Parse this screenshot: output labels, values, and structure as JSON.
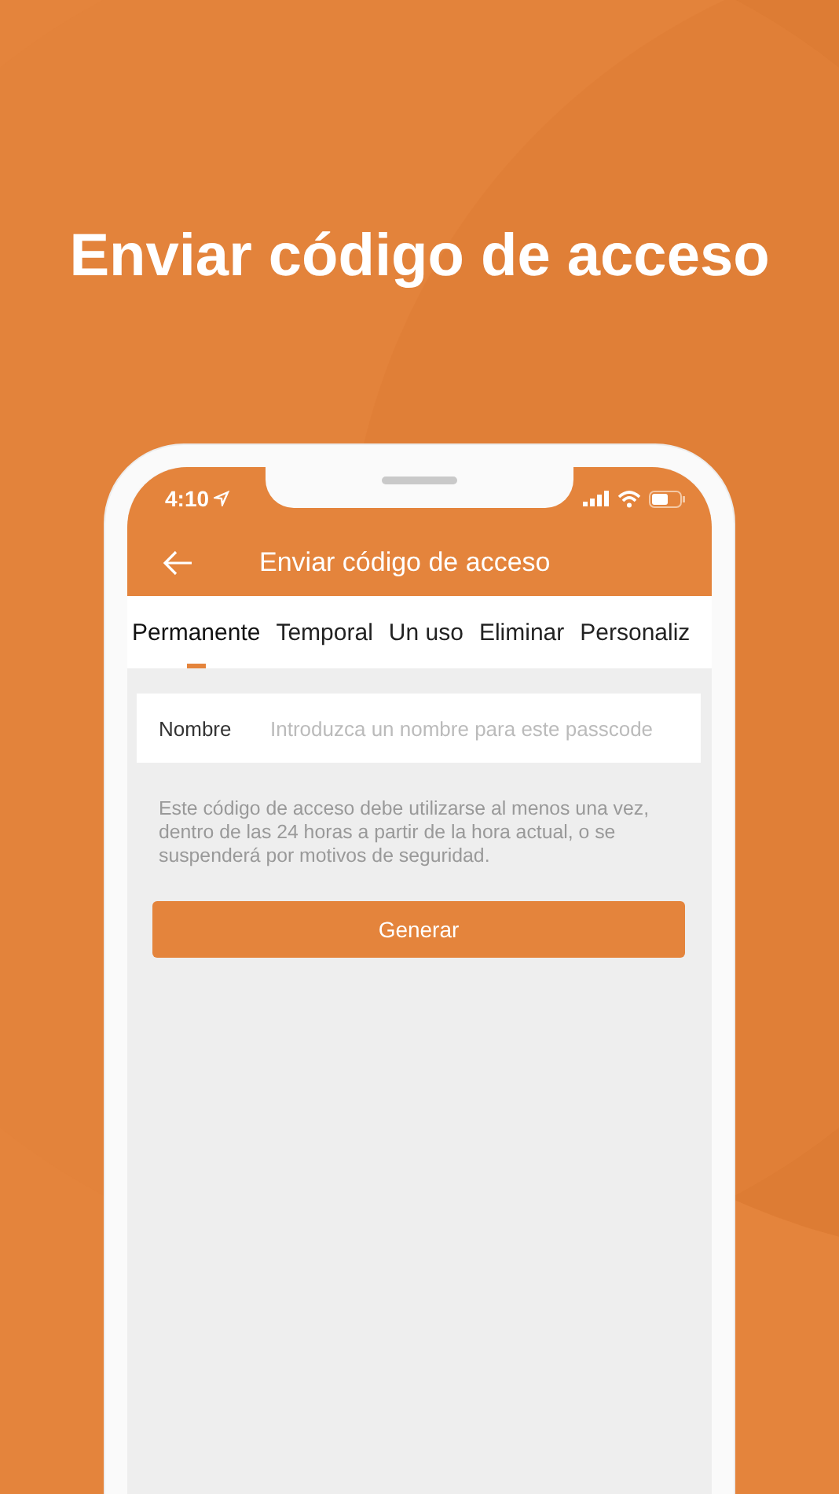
{
  "headline": "Enviar código de acceso",
  "status_bar": {
    "time": "4:10"
  },
  "nav_bar": {
    "title": "Enviar código de acceso"
  },
  "tabs": [
    {
      "label": "Permanente",
      "selected": true
    },
    {
      "label": "Temporal",
      "selected": false
    },
    {
      "label": "Un uso",
      "selected": false
    },
    {
      "label": "Eliminar",
      "selected": false
    },
    {
      "label": "Personaliz",
      "selected": false
    }
  ],
  "name_field": {
    "label": "Nombre",
    "placeholder": "Introduzca un nombre para este passcode"
  },
  "notice": "Este código de acceso debe utilizarse al menos una vez, dentro de las 24 horas a partir de la hora actual, o se suspenderá por motivos de seguridad.",
  "buttons": [
    "Generar"
  ]
}
